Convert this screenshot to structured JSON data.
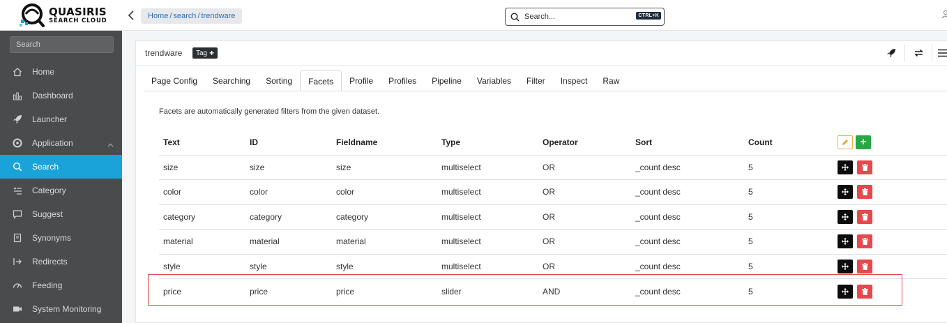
{
  "brand": {
    "title": "QUASIRIS",
    "subtitle": "SEARCH CLOUD"
  },
  "breadcrumb": [
    "Home",
    "search",
    "trendware"
  ],
  "top_search": {
    "label": "Search...",
    "shortcut": "CTRL+K"
  },
  "sidebar": {
    "search_placeholder": "Search",
    "items": [
      {
        "label": "Home",
        "icon": "home-icon"
      },
      {
        "label": "Dashboard",
        "icon": "bar-chart-icon"
      },
      {
        "label": "Launcher",
        "icon": "rocket-icon"
      },
      {
        "label": "Application",
        "icon": "application-icon"
      },
      {
        "label": "Search",
        "icon": "search-icon"
      },
      {
        "label": "Category",
        "icon": "category-icon"
      },
      {
        "label": "Suggest",
        "icon": "chat-icon"
      },
      {
        "label": "Synonyms",
        "icon": "book-icon"
      },
      {
        "label": "Redirects",
        "icon": "redirect-icon"
      },
      {
        "label": "Feeding",
        "icon": "gauge-icon"
      },
      {
        "label": "System Monitoring",
        "icon": "video-icon"
      }
    ],
    "active": "Search"
  },
  "panel": {
    "index_name": "trendware",
    "tag_label": "Tag",
    "tabs": [
      "Page Config",
      "Searching",
      "Sorting",
      "Facets",
      "Profile",
      "Profiles",
      "Pipeline",
      "Variables",
      "Filter",
      "Inspect",
      "Raw"
    ],
    "active_tab": "Facets",
    "description": "Facets are automatically generated filters from the given dataset."
  },
  "table": {
    "headers": [
      "Text",
      "ID",
      "Fieldname",
      "Type",
      "Operator",
      "Sort",
      "Count"
    ],
    "rows": [
      [
        "size",
        "size",
        "size",
        "multiselect",
        "OR",
        "_count desc",
        "5"
      ],
      [
        "color",
        "color",
        "color",
        "multiselect",
        "OR",
        "_count desc",
        "5"
      ],
      [
        "category",
        "category",
        "category",
        "multiselect",
        "OR",
        "_count desc",
        "5"
      ],
      [
        "material",
        "material",
        "material",
        "multiselect",
        "OR",
        "_count desc",
        "5"
      ],
      [
        "style",
        "style",
        "style",
        "multiselect",
        "OR",
        "_count desc",
        "5"
      ],
      [
        "price",
        "price",
        "price",
        "slider",
        "AND",
        "_count desc",
        "5"
      ]
    ]
  },
  "colors": {
    "accent": "#1aa3d9",
    "sidebar": "#494b4d",
    "add": "#28a745",
    "delete": "#e5484d",
    "edit": "#f0ad4e",
    "highlight": "#e5484d"
  }
}
